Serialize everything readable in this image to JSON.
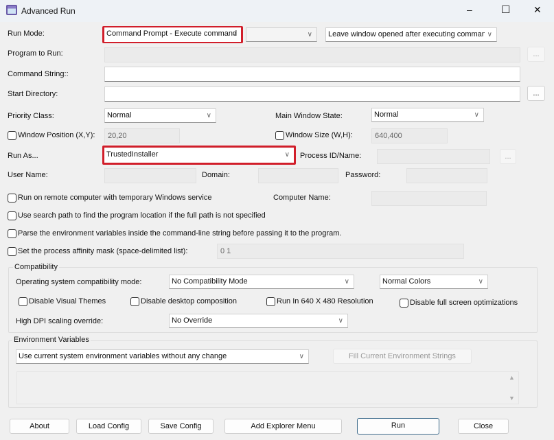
{
  "window": {
    "title": "Advanced Run",
    "minimize": "–",
    "maximize": "☐",
    "close": "✕"
  },
  "run_mode": {
    "label": "Run Mode:",
    "value": "Command Prompt - Execute command",
    "secondary": "",
    "window_option": "Leave window opened after executing command"
  },
  "program": {
    "label": "Program to Run:",
    "value": "",
    "browse": "..."
  },
  "command": {
    "label": "Command String::",
    "value": ""
  },
  "start_dir": {
    "label": "Start Directory:",
    "value": "",
    "browse": "..."
  },
  "priority": {
    "label": "Priority Class:",
    "value": "Normal"
  },
  "main_window_state": {
    "label": "Main Window State:",
    "value": "Normal"
  },
  "window_position": {
    "label": "Window Position (X,Y):",
    "value": "20,20",
    "checked": false
  },
  "window_size": {
    "label": "Window Size (W,H):",
    "value": "640,400",
    "checked": false
  },
  "run_as": {
    "label": "Run As...",
    "value": "TrustedInstaller",
    "process_label": "Process ID/Name:",
    "process_value": "",
    "browse": "..."
  },
  "credentials": {
    "user_label": "User Name:",
    "domain_label": "Domain:",
    "password_label": "Password:"
  },
  "options": {
    "remote": "Run on remote computer with temporary Windows service",
    "computer_label": "Computer Name:",
    "search_path": "Use search path to find the program location if the full path is not specified",
    "parse_env": "Parse the environment variables inside the command-line string before passing it to the program.",
    "affinity": "Set the process affinity mask (space-delimited list):",
    "affinity_value": "0 1"
  },
  "compatibility": {
    "title": "Compatibility",
    "os_label": "Operating system compatibility mode:",
    "os_value": "No Compatibility Mode",
    "colors_value": "Normal Colors",
    "disable_themes": "Disable Visual Themes",
    "disable_composition": "Disable desktop composition",
    "run_640": "Run In 640 X 480 Resolution",
    "disable_fullscreen": "Disable full screen optimizations",
    "dpi_label": "High DPI scaling override:",
    "dpi_value": "No Override"
  },
  "environment": {
    "title": "Environment Variables",
    "value": "Use current system environment variables without any change",
    "fill_button": "Fill Current Environment Strings",
    "scroll_up": "▲",
    "scroll_down": "▼"
  },
  "buttons": {
    "about": "About",
    "load": "Load Config",
    "save": "Save Config",
    "explorer": "Add Explorer Menu",
    "run": "Run",
    "close": "Close"
  },
  "colors": {
    "highlight": "#d11e2a"
  }
}
